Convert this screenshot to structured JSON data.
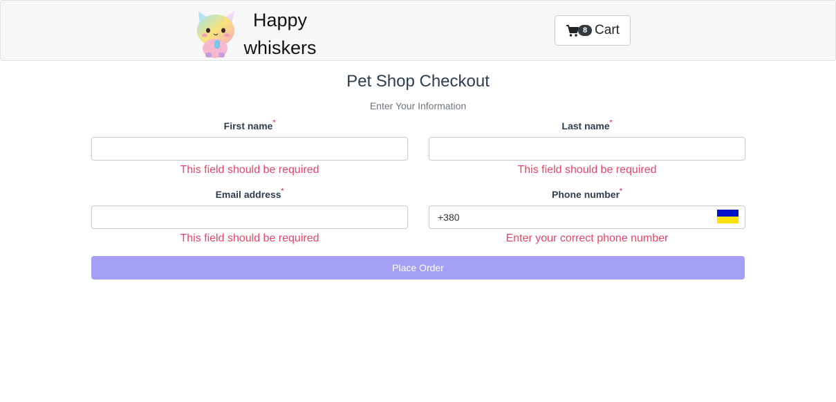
{
  "header": {
    "brand_line1": "Happy",
    "brand_line2": "whiskers",
    "cart_count": "8",
    "cart_label": "Cart"
  },
  "page": {
    "title": "Pet Shop Checkout",
    "subtitle": "Enter Your Information"
  },
  "form": {
    "required_marker": "*",
    "first_name": {
      "label": "First name",
      "value": "",
      "error": "This field should be required"
    },
    "last_name": {
      "label": "Last name",
      "value": "",
      "error": "This field should be required"
    },
    "email": {
      "label": "Email address",
      "value": "",
      "error": "This field should be required"
    },
    "phone": {
      "label": "Phone number",
      "value": "+380",
      "error": "Enter your correct phone number",
      "flag_icon": "ukraine-flag-icon"
    },
    "submit_label": "Place Order"
  },
  "colors": {
    "error": "#e8436a",
    "submit_disabled": "#a49ef5",
    "navbar_bg": "#f7f7f7",
    "flag_blue": "#0013c8",
    "flag_yellow": "#ffe400"
  }
}
